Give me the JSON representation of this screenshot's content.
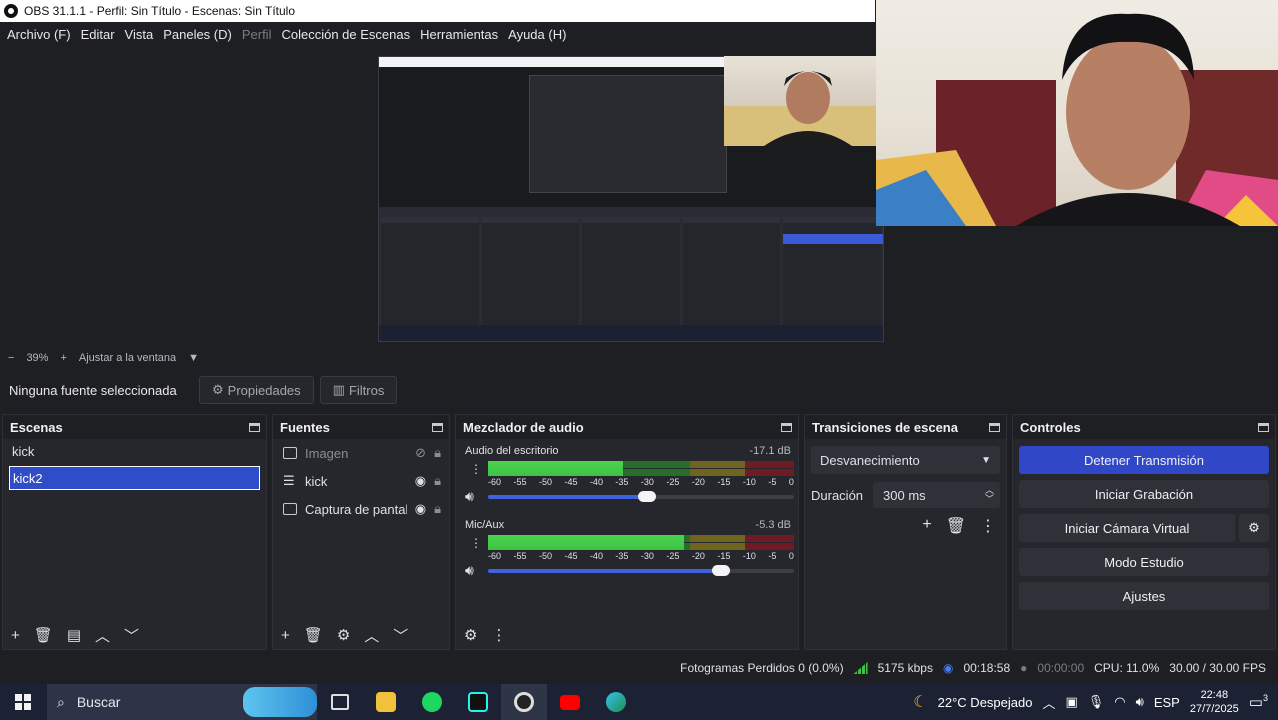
{
  "window": {
    "title": "OBS 31.1.1 - Perfil: Sin Título - Escenas: Sin Título"
  },
  "menu": [
    "Archivo (F)",
    "Editar",
    "Vista",
    "Paneles (D)",
    "Perfil",
    "Colección de Escenas",
    "Herramientas",
    "Ayuda (H)"
  ],
  "zoom": {
    "minus": "−",
    "level": "39%",
    "plus": "+",
    "fit": "Ajustar a la ventana"
  },
  "source_toolbar": {
    "none_selected": "Ninguna fuente seleccionada",
    "properties": "Propiedades",
    "filters": "Filtros"
  },
  "scenes": {
    "title": "Escenas",
    "items": [
      "kick",
      "kick2"
    ],
    "selected": "kick2"
  },
  "sources": {
    "title": "Fuentes",
    "items": [
      {
        "name": "Imagen",
        "icon": "image-icon",
        "visible": false
      },
      {
        "name": "kick",
        "icon": "list-icon",
        "visible": true
      },
      {
        "name": "Captura de pantalla",
        "icon": "display-icon",
        "visible": true
      }
    ]
  },
  "mixer": {
    "title": "Mezclador de audio",
    "channels": [
      {
        "name": "Audio del escritorio",
        "db": "-17.1 dB",
        "level": 0.44,
        "volume": 0.52
      },
      {
        "name": "Mic/Aux",
        "db": "-5.3 dB",
        "level": 0.64,
        "volume": 0.76
      }
    ],
    "scale": [
      "-60",
      "-55",
      "-50",
      "-45",
      "-40",
      "-35",
      "-30",
      "-25",
      "-20",
      "-15",
      "-10",
      "-5",
      "0"
    ]
  },
  "transitions": {
    "title": "Transiciones de escena",
    "selected": "Desvanecimiento",
    "duration_label": "Duración",
    "duration": "300 ms"
  },
  "controls": {
    "title": "Controles",
    "stream": "Detener Transmisión",
    "record": "Iniciar Grabación",
    "virtual_cam": "Iniciar Cámara Virtual",
    "studio": "Modo Estudio",
    "settings": "Ajustes"
  },
  "status": {
    "dropped": "Fotogramas Perdidos 0 (0.0%)",
    "bitrate": "5175 kbps",
    "stream_time": "00:18:58",
    "rec_time": "00:00:00",
    "cpu": "CPU: 11.0%",
    "fps": "30.00 / 30.00 FPS"
  },
  "taskbar": {
    "search": "Buscar",
    "weather": "22°C  Despejado",
    "lang": "ESP",
    "time": "22:48",
    "date": "27/7/2025",
    "notif": "3"
  },
  "colors": {
    "accent": "#3048c8",
    "bg": "#1e1f23",
    "panel": "#26272d",
    "meter_green": "#3ec244"
  }
}
